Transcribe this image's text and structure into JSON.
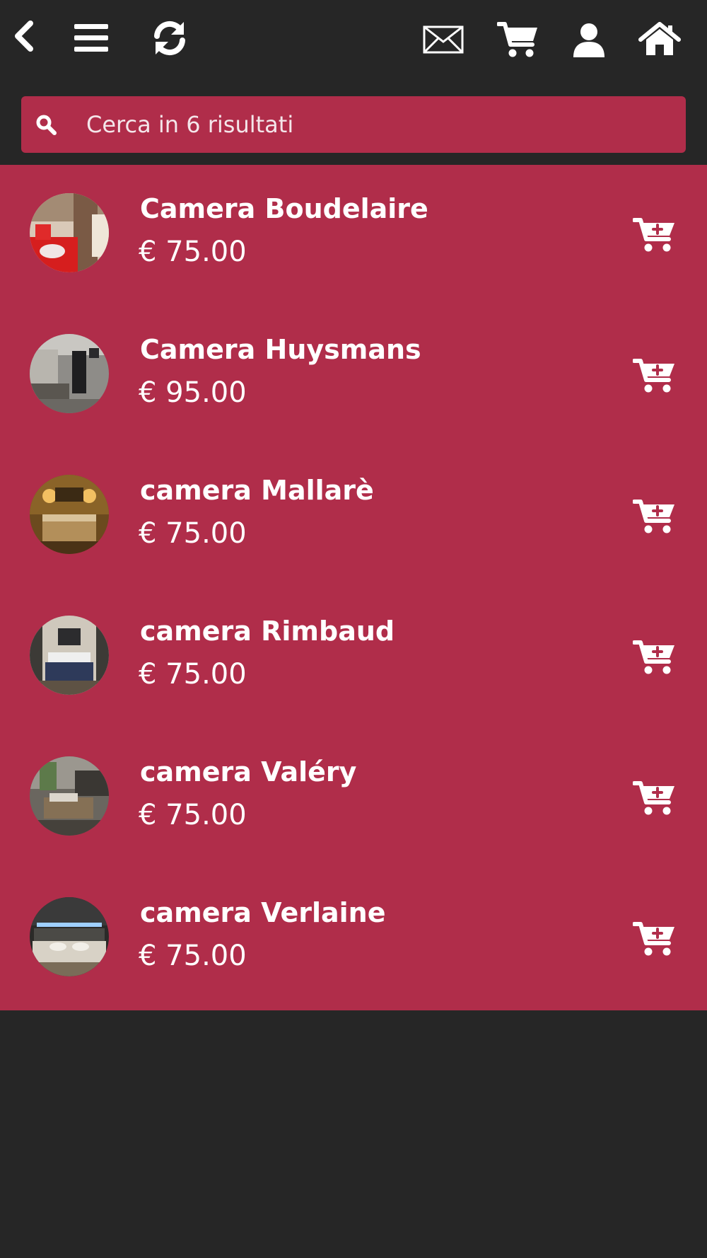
{
  "topbar": {
    "icons": [
      "back-icon",
      "menu-icon",
      "refresh-icon",
      "mail-icon",
      "cart-icon",
      "user-icon",
      "home-icon"
    ]
  },
  "search": {
    "placeholder": "Cerca in 6 risultati",
    "icon": "search-icon"
  },
  "colors": {
    "background": "#262626",
    "accent": "#b02d4a",
    "text": "#ffffff"
  },
  "items": [
    {
      "name": "Camera Boudelaire",
      "price": "€ 75.00"
    },
    {
      "name": "Camera Huysmans",
      "price": "€ 95.00"
    },
    {
      "name": "camera Mallarè",
      "price": "€ 75.00"
    },
    {
      "name": "camera Rimbaud",
      "price": "€ 75.00"
    },
    {
      "name": "camera Valéry",
      "price": "€ 75.00"
    },
    {
      "name": "camera Verlaine",
      "price": "€ 75.00"
    }
  ]
}
